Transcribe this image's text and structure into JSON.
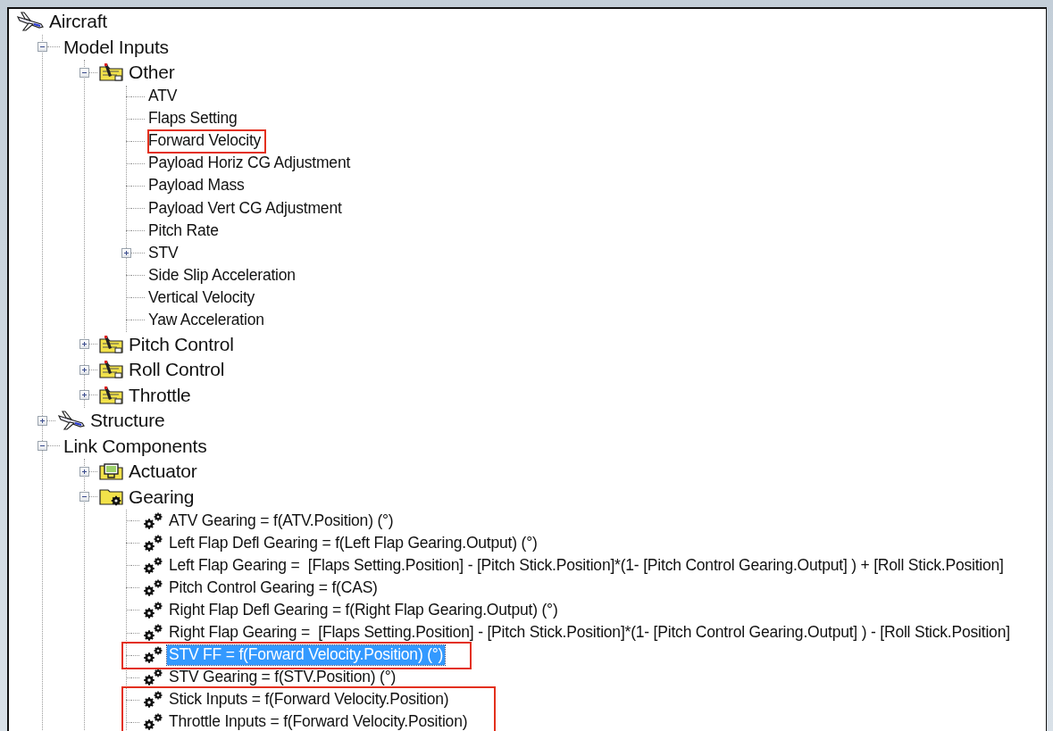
{
  "tree": {
    "label": "Aircraft",
    "kind": "plane",
    "selected": false,
    "children": [
      {
        "label": "Model Inputs",
        "kind": "group",
        "selected": false,
        "expanded": true,
        "children": [
          {
            "label": "Other",
            "kind": "input",
            "selected": false,
            "expanded": true,
            "children": [
              {
                "label": "ATV",
                "kind": "leaf",
                "selected": false
              },
              {
                "label": "Flaps Setting",
                "kind": "leaf",
                "selected": false
              },
              {
                "label": "Forward Velocity",
                "kind": "leaf",
                "selected": false,
                "boxed": true
              },
              {
                "label": "Payload Horiz CG Adjustment",
                "kind": "leaf",
                "selected": false
              },
              {
                "label": "Payload Mass",
                "kind": "leaf",
                "selected": false
              },
              {
                "label": "Payload Vert CG Adjustment",
                "kind": "leaf",
                "selected": false
              },
              {
                "label": "Pitch Rate",
                "kind": "leaf",
                "selected": false
              },
              {
                "label": "STV",
                "kind": "leaf",
                "selected": false,
                "expanded": false
              },
              {
                "label": "Side Slip Acceleration",
                "kind": "leaf",
                "selected": false
              },
              {
                "label": "Vertical Velocity",
                "kind": "leaf",
                "selected": false
              },
              {
                "label": "Yaw Acceleration",
                "kind": "leaf",
                "selected": false
              }
            ]
          },
          {
            "label": "Pitch Control",
            "kind": "input",
            "selected": false,
            "expanded": false
          },
          {
            "label": "Roll Control",
            "kind": "input",
            "selected": false,
            "expanded": false
          },
          {
            "label": "Throttle",
            "kind": "input",
            "selected": false,
            "expanded": false
          }
        ]
      },
      {
        "label": "Structure",
        "kind": "plane",
        "selected": false,
        "expanded": false
      },
      {
        "label": "Link Components",
        "kind": "group",
        "selected": false,
        "expanded": true,
        "children": [
          {
            "label": "Actuator",
            "kind": "monitor",
            "selected": false,
            "expanded": false
          },
          {
            "label": "Gearing",
            "kind": "gearfolder",
            "selected": false,
            "expanded": true,
            "children": [
              {
                "label": "ATV Gearing = f(ATV.Position) (°)",
                "kind": "gears",
                "selected": false
              },
              {
                "label": "Left Flap Defl Gearing = f(Left Flap Gearing.Output) (°)",
                "kind": "gears",
                "selected": false
              },
              {
                "label": "Left Flap Gearing =  [Flaps Setting.Position] - [Pitch Stick.Position]*(1- [Pitch Control Gearing.Output] ) + [Roll Stick.Position]",
                "kind": "gears",
                "selected": false
              },
              {
                "label": "Pitch Control Gearing = f(CAS)",
                "kind": "gears",
                "selected": false
              },
              {
                "label": "Right Flap Defl Gearing = f(Right Flap Gearing.Output) (°)",
                "kind": "gears",
                "selected": false
              },
              {
                "label": "Right Flap Gearing =  [Flaps Setting.Position] - [Pitch Stick.Position]*(1- [Pitch Control Gearing.Output] ) - [Roll Stick.Position]",
                "kind": "gears",
                "selected": false
              },
              {
                "label": "STV FF = f(Forward Velocity.Position) (°)",
                "kind": "gears",
                "selected": true,
                "boxed": true
              },
              {
                "label": "STV Gearing = f(STV.Position) (°)",
                "kind": "gears",
                "selected": false
              },
              {
                "label": "Stick Inputs = f(Forward Velocity.Position)",
                "kind": "gears",
                "selected": false,
                "boxed": true
              },
              {
                "label": "Throttle Inputs = f(Forward Velocity.Position)",
                "kind": "gears",
                "selected": false,
                "boxed": true
              }
            ]
          }
        ]
      }
    ]
  }
}
